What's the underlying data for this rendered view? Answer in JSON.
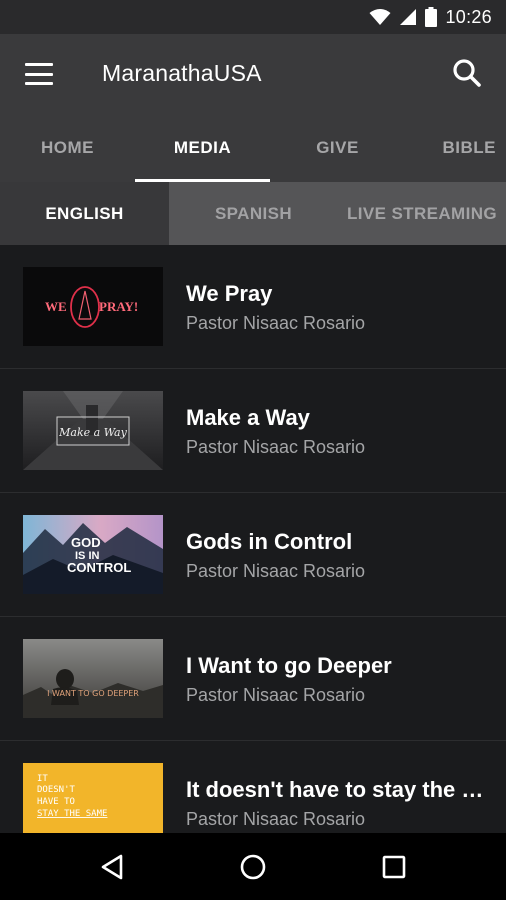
{
  "status_bar": {
    "time": "10:26",
    "icons": [
      "wifi-icon",
      "signal-icon",
      "battery-icon"
    ]
  },
  "app_bar": {
    "title": "MaranathaUSA",
    "menu_icon": "menu-icon",
    "search_icon": "search-icon"
  },
  "main_tabs": [
    {
      "label": "HOME",
      "active": false
    },
    {
      "label": "MEDIA",
      "active": true
    },
    {
      "label": "GIVE",
      "active": false
    },
    {
      "label": "BIBLE",
      "active": false
    }
  ],
  "sub_tabs": [
    {
      "label": "ENGLISH",
      "active": true
    },
    {
      "label": "SPANISH",
      "active": false
    },
    {
      "label": "LIVE STREAMING",
      "active": false
    }
  ],
  "media_items": [
    {
      "title": "We Pray",
      "subtitle": "Pastor Nisaac Rosario",
      "thumb_text": [
        "WE",
        "PRAY!"
      ]
    },
    {
      "title": "Make a Way",
      "subtitle": "Pastor Nisaac Rosario",
      "thumb_text": [
        "Make a Way"
      ]
    },
    {
      "title": "Gods in Control",
      "subtitle": "Pastor Nisaac Rosario",
      "thumb_text": [
        "GOD",
        "IS IN",
        "CONTROL"
      ]
    },
    {
      "title": "I Want to go Deeper",
      "subtitle": "Pastor Nisaac Rosario",
      "thumb_text": [
        "I WANT TO GO DEEPER"
      ]
    },
    {
      "title": "It doesn't have to stay the same",
      "subtitle": "Pastor Nisaac Rosario",
      "thumb_text": [
        "IT",
        "DOESN'T",
        "HAVE TO",
        "STAY THE SAME"
      ]
    }
  ],
  "nav_bar": {
    "icons": [
      "back-icon",
      "home-icon",
      "recents-icon"
    ]
  },
  "colors": {
    "app_bar": "#3a3a3c",
    "sub_tabs": "#555557",
    "list_bg": "#1a1b1d",
    "accent_red": "#e0304a",
    "thumb_yellow": "#f2b52a"
  }
}
